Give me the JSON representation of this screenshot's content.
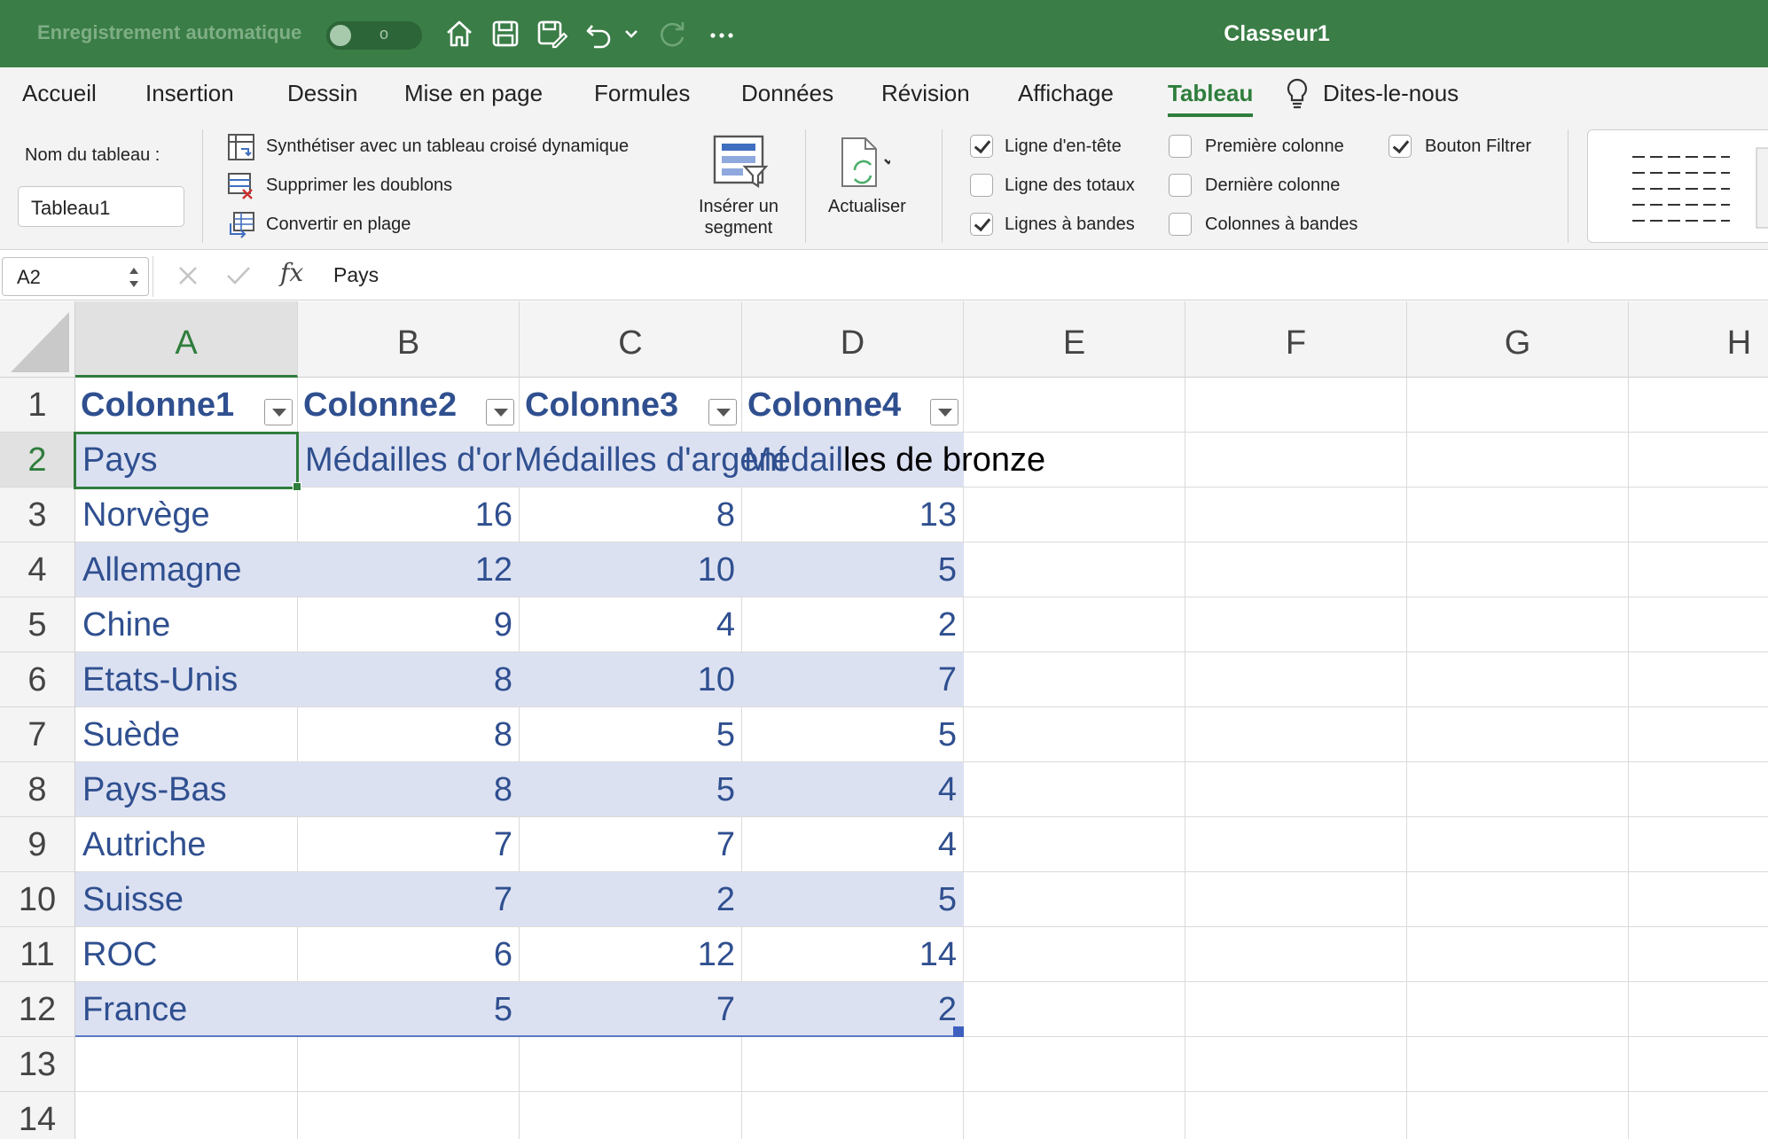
{
  "titlebar": {
    "autosave_label": "Enregistrement automatique",
    "autosave_state": "o",
    "doc_title": "Classeur1",
    "icons": [
      "home-icon",
      "save-icon",
      "save-as-icon",
      "undo-icon",
      "undo-dropdown-icon",
      "redo-icon",
      "more-icon"
    ]
  },
  "tabs": [
    {
      "label": "Accueil"
    },
    {
      "label": "Insertion"
    },
    {
      "label": "Dessin"
    },
    {
      "label": "Mise en page"
    },
    {
      "label": "Formules"
    },
    {
      "label": "Données"
    },
    {
      "label": "Révision"
    },
    {
      "label": "Affichage"
    },
    {
      "label": "Tableau",
      "active": true
    },
    {
      "label": "Dites-le-nous"
    }
  ],
  "ribbon": {
    "table_name_label": "Nom du tableau :",
    "table_name_value": "Tableau1",
    "tools": {
      "pivot": "Synthétiser avec un tableau croisé dynamique",
      "remove_duplicates": "Supprimer les doublons",
      "convert_range": "Convertir en plage"
    },
    "slicer": {
      "line1": "Insérer un",
      "line2": "segment"
    },
    "refresh": "Actualiser",
    "options": [
      {
        "label": "Ligne d'en-tête",
        "checked": true
      },
      {
        "label": "Ligne des totaux",
        "checked": false
      },
      {
        "label": "Lignes à bandes",
        "checked": true
      },
      {
        "label": "Première colonne",
        "checked": false
      },
      {
        "label": "Dernière colonne",
        "checked": false
      },
      {
        "label": "Colonnes à bandes",
        "checked": false
      },
      {
        "label": "Bouton Filtrer",
        "checked": true
      }
    ]
  },
  "formula_bar": {
    "cell_ref": "A2",
    "fx": "fx",
    "value": "Pays"
  },
  "grid": {
    "columns": [
      "A",
      "B",
      "C",
      "D",
      "E",
      "F",
      "G",
      "H"
    ],
    "selected_column": "A",
    "rows": [
      "1",
      "2",
      "3",
      "4",
      "5",
      "6",
      "7",
      "8",
      "9",
      "10",
      "11",
      "12",
      "13",
      "14"
    ],
    "selected_row": "2",
    "table_header": [
      "Colonne1",
      "Colonne2",
      "Colonne3",
      "Colonne4"
    ],
    "row2": {
      "a": "Pays",
      "b": "Médailles d'or",
      "c": "Médailles d'argent",
      "d_part1": "Médail",
      "d_part2": "les de bronze"
    },
    "data": [
      [
        "Norvège",
        "16",
        "8",
        "13"
      ],
      [
        "Allemagne",
        "12",
        "10",
        "5"
      ],
      [
        "Chine",
        "9",
        "4",
        "2"
      ],
      [
        "Etats-Unis",
        "8",
        "10",
        "7"
      ],
      [
        "Suède",
        "8",
        "5",
        "5"
      ],
      [
        "Pays-Bas",
        "8",
        "5",
        "4"
      ],
      [
        "Autriche",
        "7",
        "7",
        "4"
      ],
      [
        "Suisse",
        "7",
        "2",
        "5"
      ],
      [
        "ROC",
        "6",
        "12",
        "14"
      ],
      [
        "France",
        "5",
        "7",
        "2"
      ]
    ]
  },
  "colors": {
    "title_green": "#3a7d46",
    "accent_green": "#2f7d3c",
    "band_blue": "#dce1f2",
    "table_text": "#2f4f8f"
  }
}
